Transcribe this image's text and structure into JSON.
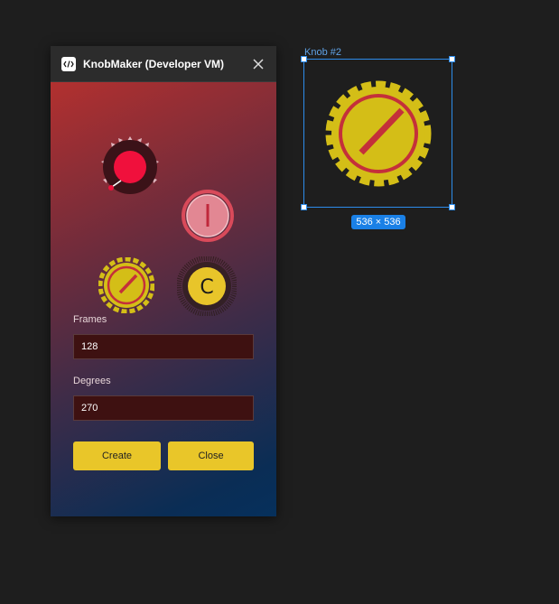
{
  "window": {
    "title": "KnobMaker (Developer VM)"
  },
  "knob_styles": [
    {
      "name": "Red dotted knob"
    },
    {
      "name": "Pink ring knob"
    },
    {
      "name": "Yellow gear knob"
    },
    {
      "name": "Yellow C knob",
      "glyph": "C"
    }
  ],
  "form": {
    "frames_label": "Frames",
    "frames_value": "128",
    "degrees_label": "Degrees",
    "degrees_value": "270"
  },
  "buttons": {
    "create_label": "Create",
    "close_label": "Close"
  },
  "canvas": {
    "layer_name": "Knob #2",
    "size_label": "536 × 536"
  },
  "colors": {
    "accent": "#e9c629",
    "selection": "#2d8ceb",
    "knob_yellow": "#d4be17",
    "knob_red": "#c4303a"
  }
}
